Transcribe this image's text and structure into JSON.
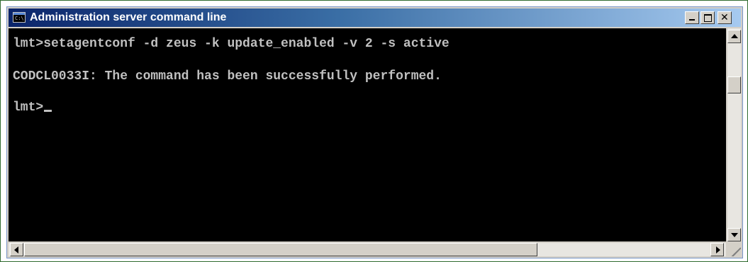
{
  "window": {
    "title": "Administration server command line",
    "icon": "console-icon",
    "icon_glyph": "C:\\",
    "controls": {
      "minimize": "minimize-icon",
      "maximize": "maximize-icon",
      "close_label": "✕"
    }
  },
  "console": {
    "line1": "lmt>setagentconf -d zeus -k update_enabled -v 2 -s active",
    "line2": "CODCL0033I: The command has been successfully performed.",
    "line3_prompt": "lmt>"
  },
  "colors": {
    "console_bg": "#000000",
    "console_text": "#c0c0c0",
    "titlebar_start": "#0a246a",
    "titlebar_end": "#a6caf0",
    "chrome": "#d4d0c8"
  }
}
